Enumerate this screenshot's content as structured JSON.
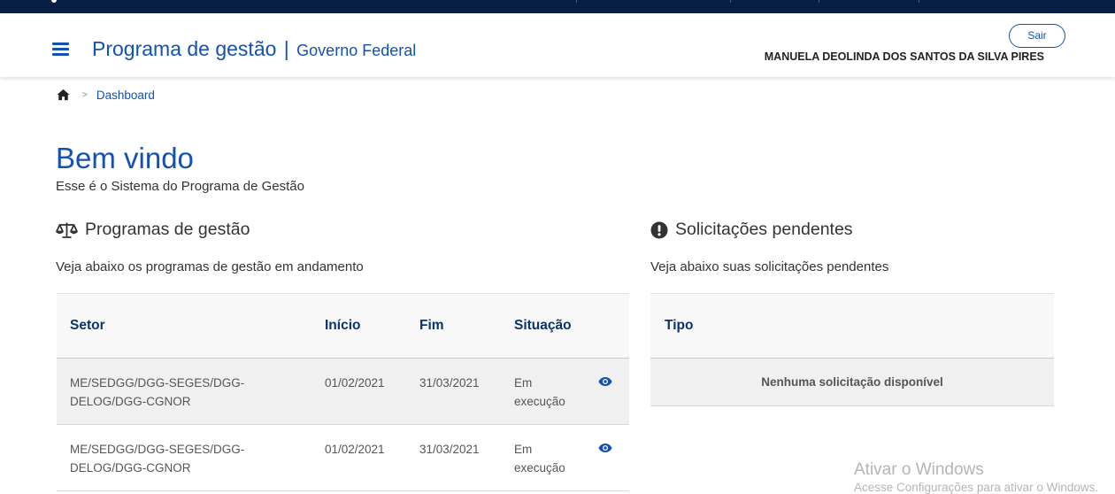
{
  "header": {
    "title": "Programa de gestão",
    "separator": "|",
    "subtitle": "Governo Federal",
    "logout_label": "Sair",
    "user_name": "MANUELA DEOLINDA DOS SANTOS DA SILVA PIRES"
  },
  "breadcrumb": {
    "current": "Dashboard"
  },
  "welcome": {
    "title": "Bem vindo",
    "subtitle": "Esse é o Sistema do Programa de Gestão"
  },
  "programs": {
    "title": "Programas de gestão",
    "description": "Veja abaixo os programas de gestão em andamento",
    "columns": [
      "Setor",
      "Início",
      "Fim",
      "Situação"
    ],
    "rows": [
      {
        "setor_line1": "ME/SEDGG/DGG-SEGES/DGG-",
        "setor_line2": "DELOG/DGG-CGNOR",
        "inicio": "01/02/2021",
        "fim": "31/03/2021",
        "situacao_line1": "Em",
        "situacao_line2": "execução"
      },
      {
        "setor_line1": "ME/SEDGG/DGG-SEGES/DGG-",
        "setor_line2": "DELOG/DGG-CGNOR",
        "inicio": "01/02/2021",
        "fim": "31/03/2021",
        "situacao_line1": "Em",
        "situacao_line2": "execução"
      }
    ]
  },
  "requests": {
    "title": "Solicitações pendentes",
    "description": "Veja abaixo suas solicitações pendentes",
    "columns": [
      "Tipo"
    ],
    "empty_message": "Nenhuma solicitação disponível"
  },
  "watermark": {
    "line1": "Ativar o Windows",
    "line2": "Acesse Configurações para ativar o Windows."
  },
  "colors": {
    "gov_bar": "#071d41",
    "primary": "#1351b4",
    "table_header_text": "#0c326f"
  },
  "icons": [
    "menu-icon",
    "home-icon",
    "balance-scale-icon",
    "exclamation-circle-icon",
    "eye-icon"
  ]
}
